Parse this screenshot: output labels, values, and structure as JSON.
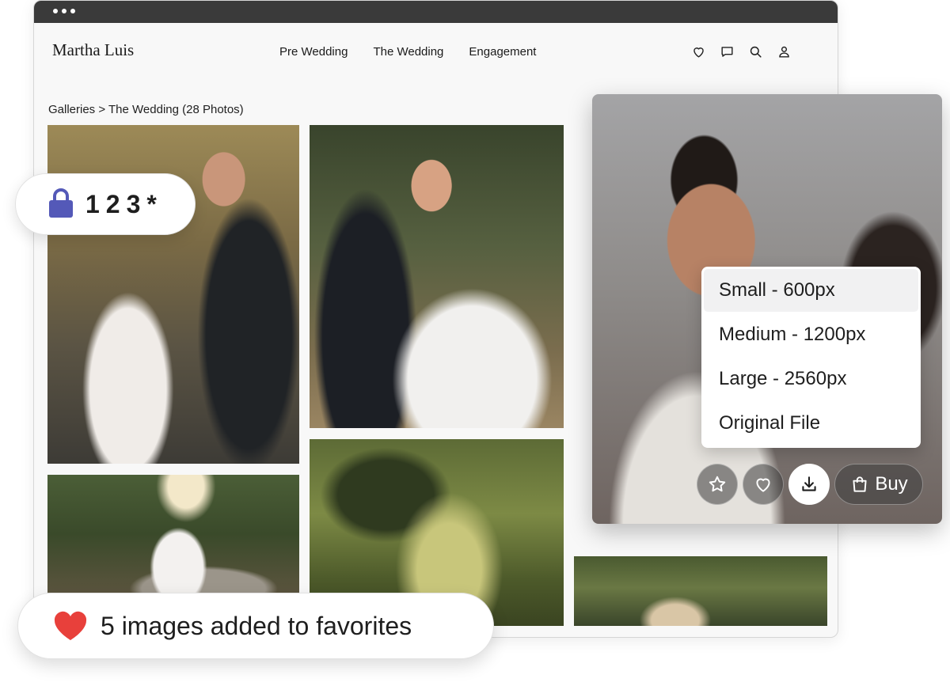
{
  "brand": {
    "logo": "Martha Luis"
  },
  "nav": {
    "items": [
      "Pre Wedding",
      "The Wedding",
      "Engagement"
    ]
  },
  "header_icons": [
    "heart-icon",
    "chat-icon",
    "search-icon",
    "user-icon"
  ],
  "breadcrumb": {
    "text": "Galleries > The Wedding (28 Photos)"
  },
  "download_menu": {
    "selected_index": 0,
    "options": [
      "Small - 600px",
      "Medium - 1200px",
      "Large - 2560px",
      "Original File"
    ]
  },
  "photo_actions": {
    "buy_label": "Buy",
    "icons": [
      "star-icon",
      "heart-icon",
      "download-icon",
      "shopping-bag-icon"
    ]
  },
  "pin_badge": {
    "code": "123*"
  },
  "favorites_toast": {
    "message": "5 images added to favorites"
  },
  "colors": {
    "lock": "#5459b8",
    "heart": "#e8403b",
    "titlebar": "#3a3a3a"
  }
}
